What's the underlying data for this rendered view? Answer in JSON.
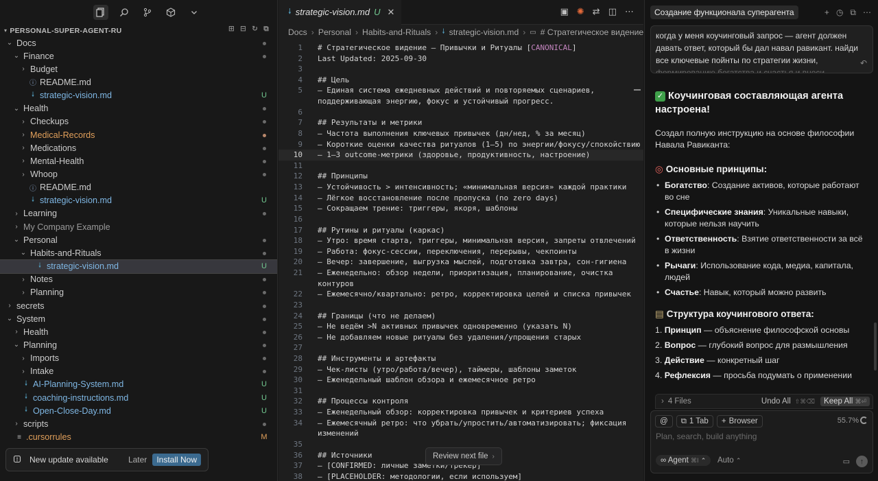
{
  "sidebar": {
    "title": "PERSONAL-SUPER-AGENT-RU",
    "tree": [
      {
        "label": "Docs",
        "kind": "folder",
        "open": true,
        "depth": 1,
        "status": "dot",
        "color": "default"
      },
      {
        "label": "Finance",
        "kind": "folder",
        "open": true,
        "depth": 2,
        "status": "dot",
        "color": "default"
      },
      {
        "label": "Budget",
        "kind": "folder",
        "open": false,
        "depth": 3,
        "status": "",
        "color": "default"
      },
      {
        "label": "README.md",
        "kind": "info",
        "depth": 3,
        "status": "",
        "color": "default"
      },
      {
        "label": "strategic-vision.md",
        "kind": "md",
        "depth": 3,
        "status": "U",
        "color": "untracked"
      },
      {
        "label": "Health",
        "kind": "folder",
        "open": true,
        "depth": 2,
        "status": "dot",
        "color": "default"
      },
      {
        "label": "Checkups",
        "kind": "folder",
        "open": false,
        "depth": 3,
        "status": "dot",
        "color": "default"
      },
      {
        "label": "Medical-Records",
        "kind": "folder",
        "open": false,
        "depth": 3,
        "status": "dot-orange",
        "color": "modified"
      },
      {
        "label": "Medications",
        "kind": "folder",
        "open": false,
        "depth": 3,
        "status": "dot",
        "color": "default"
      },
      {
        "label": "Mental-Health",
        "kind": "folder",
        "open": false,
        "depth": 3,
        "status": "dot",
        "color": "default"
      },
      {
        "label": "Whoop",
        "kind": "folder",
        "open": false,
        "depth": 3,
        "status": "dot",
        "color": "default"
      },
      {
        "label": "README.md",
        "kind": "info",
        "depth": 3,
        "status": "",
        "color": "default"
      },
      {
        "label": "strategic-vision.md",
        "kind": "md",
        "depth": 3,
        "status": "U",
        "color": "untracked"
      },
      {
        "label": "Learning",
        "kind": "folder",
        "open": false,
        "depth": 2,
        "status": "dot",
        "color": "default"
      },
      {
        "label": "My Company Example",
        "kind": "folder",
        "open": false,
        "depth": 2,
        "status": "",
        "color": "dim"
      },
      {
        "label": "Personal",
        "kind": "folder",
        "open": true,
        "depth": 2,
        "status": "dot",
        "color": "default"
      },
      {
        "label": "Habits-and-Rituals",
        "kind": "folder",
        "open": true,
        "depth": 3,
        "status": "dot",
        "color": "default"
      },
      {
        "label": "strategic-vision.md",
        "kind": "md",
        "depth": 4,
        "status": "U",
        "color": "untracked",
        "selected": true
      },
      {
        "label": "Notes",
        "kind": "folder",
        "open": false,
        "depth": 3,
        "status": "dot",
        "color": "default"
      },
      {
        "label": "Planning",
        "kind": "folder",
        "open": false,
        "depth": 3,
        "status": "dot",
        "color": "default"
      },
      {
        "label": "secrets",
        "kind": "folder",
        "open": false,
        "depth": 1,
        "status": "dot",
        "color": "default"
      },
      {
        "label": "System",
        "kind": "folder",
        "open": true,
        "depth": 1,
        "status": "dot",
        "color": "default"
      },
      {
        "label": "Health",
        "kind": "folder",
        "open": false,
        "depth": 2,
        "status": "dot",
        "color": "default"
      },
      {
        "label": "Planning",
        "kind": "folder",
        "open": true,
        "depth": 2,
        "status": "dot",
        "color": "default"
      },
      {
        "label": "Imports",
        "kind": "folder",
        "open": false,
        "depth": 3,
        "status": "dot",
        "color": "default"
      },
      {
        "label": "Intake",
        "kind": "folder",
        "open": false,
        "depth": 3,
        "status": "dot",
        "color": "default"
      },
      {
        "label": "AI-Planning-System.md",
        "kind": "md",
        "depth": 2,
        "status": "U",
        "color": "untracked"
      },
      {
        "label": "coaching-instructions.md",
        "kind": "md",
        "depth": 2,
        "status": "U",
        "color": "untracked"
      },
      {
        "label": "Open-Close-Day.md",
        "kind": "md",
        "depth": 2,
        "status": "U",
        "color": "untracked"
      },
      {
        "label": "scripts",
        "kind": "folder",
        "open": false,
        "depth": 2,
        "status": "dot",
        "color": "default"
      },
      {
        "label": ".cursorrules",
        "kind": "lines",
        "depth": 1,
        "status": "M",
        "color": "modified"
      }
    ],
    "toast": {
      "message": "New update available",
      "later": "Later",
      "install": "Install Now"
    }
  },
  "editor": {
    "tab_name": "strategic-vision.md",
    "tab_status": "U",
    "breadcrumb": [
      "Docs",
      "Personal",
      "Habits-and-Rituals",
      "strategic-vision.md",
      "# Стратегическое видение"
    ],
    "current_line": 10,
    "lines": [
      {
        "n": "1",
        "t": "# Стратегическое видение — Привычки и Ритуалы [",
        "k": "CANONICAL",
        "e": "]"
      },
      {
        "n": "2",
        "t": "Last Updated: 2025-09-30"
      },
      {
        "n": "3",
        "t": ""
      },
      {
        "n": "4",
        "t": "## Цель"
      },
      {
        "n": "5",
        "t": "– Единая система ежедневных действий и повторяемых сценариев,"
      },
      {
        "n": "",
        "t": "поддерживающая энергию, фокус и устойчивый прогресс."
      },
      {
        "n": "6",
        "t": ""
      },
      {
        "n": "7",
        "t": "## Результаты и метрики"
      },
      {
        "n": "8",
        "t": "– Частота выполнения ключевых привычек (дн/нед, % за месяц)"
      },
      {
        "n": "9",
        "t": "– Короткие оценки качества ритуалов (1–5) по энергии/фокусу/спокойствию"
      },
      {
        "n": "10",
        "t": "– 1–3 outcome-метрики (здоровье, продуктивность, настроение)"
      },
      {
        "n": "11",
        "t": ""
      },
      {
        "n": "12",
        "t": "## Принципы"
      },
      {
        "n": "13",
        "t": "– Устойчивость > интенсивность; «минимальная версия» каждой практики"
      },
      {
        "n": "14",
        "t": "– Лёгкое восстановление после пропуска (no zero days)"
      },
      {
        "n": "15",
        "t": "– Сокращаем трение: триггеры, якоря, шаблоны"
      },
      {
        "n": "16",
        "t": ""
      },
      {
        "n": "17",
        "t": "## Рутины и ритуалы (каркас)"
      },
      {
        "n": "18",
        "t": "– Утро: время старта, триггеры, минимальная версия, запреты отвлечений"
      },
      {
        "n": "19",
        "t": "– Работа: фокус-сессии, переключения, перерывы, чекпоинты"
      },
      {
        "n": "20",
        "t": "– Вечер: завершение, выгрузка мыслей, подготовка завтра, сон-гигиена"
      },
      {
        "n": "21",
        "t": "– Еженедельно: обзор недели, приоритизация, планирование, очистка"
      },
      {
        "n": "",
        "t": "контуров"
      },
      {
        "n": "22",
        "t": "– Ежемесячно/квартально: ретро, корректировка целей и списка привычек"
      },
      {
        "n": "23",
        "t": ""
      },
      {
        "n": "24",
        "t": "## Границы (что не делаем)"
      },
      {
        "n": "25",
        "t": "– Не ведём >N активных привычек одновременно (указать N)"
      },
      {
        "n": "26",
        "t": "– Не добавляем новые ритуалы без удаления/упрощения старых"
      },
      {
        "n": "27",
        "t": ""
      },
      {
        "n": "28",
        "t": "## Инструменты и артефакты"
      },
      {
        "n": "29",
        "t": "– Чек-листы (утро/работа/вечер), таймеры, шаблоны заметок"
      },
      {
        "n": "30",
        "t": "– Еженедельный шаблон обзора и ежемесячное ретро"
      },
      {
        "n": "31",
        "t": ""
      },
      {
        "n": "32",
        "t": "## Процессы контроля"
      },
      {
        "n": "33",
        "t": "– Еженедельный обзор: корректировка привычек и критериев успеха"
      },
      {
        "n": "34",
        "t": "– Ежемесячный ретро: что убрать/упростить/автоматизировать; фиксация"
      },
      {
        "n": "",
        "t": "изменений"
      },
      {
        "n": "35",
        "t": ""
      },
      {
        "n": "36",
        "t": "## Источники"
      },
      {
        "n": "37",
        "t": "– [CONFIRMED: личные заметки/трекер]"
      },
      {
        "n": "38",
        "t": "– [PLACEHOLDER: методологии, если используем]"
      }
    ],
    "review_button": "Review next file"
  },
  "chat": {
    "title": "Создание функционала суперагента",
    "prompt_text": "когда у меня коучинговый запрос — агент должен давать ответ, который бы дал навал равикант. найди все ключевые пойнты по стратегии жизни,",
    "prompt_fade": "формированию богатства и счастья и внеси",
    "heading": "Коучинговая составляющая агента настроена!",
    "intro": "Создал полную инструкцию на основе философии Навала Равиканта:",
    "principles_heading": "Основные принципы:",
    "principles": [
      {
        "term": "Богатство",
        "desc": ": Создание активов, которые работают во сне"
      },
      {
        "term": "Специфические знания",
        "desc": ": Уникальные навыки, которые нельзя научить"
      },
      {
        "term": "Ответственность",
        "desc": ": Взятие ответственности за всё в жизни"
      },
      {
        "term": "Рычаги",
        "desc": ": Использование кода, медиа, капитала, людей"
      },
      {
        "term": "Счастье",
        "desc": ": Навык, который можно развить"
      }
    ],
    "structure_heading": "Структура коучингового ответа:",
    "structure": [
      {
        "num": "1.",
        "term": "Принцип",
        "desc": " — объяснение философской основы"
      },
      {
        "num": "2.",
        "term": "Вопрос",
        "desc": " — глубокий вопрос для размышления"
      },
      {
        "num": "3.",
        "term": "Действие",
        "desc": " — конкретный шаг"
      },
      {
        "num": "4.",
        "term": "Рефлексия",
        "desc": " — просьба подумать о применении"
      }
    ],
    "files_count": "4 Files",
    "undo_all": "Undo All",
    "undo_kbd": "⇧⌘⌫",
    "keep_all": "Keep All",
    "keep_kbd": "⌘⏎",
    "tab_chip": "1 Tab",
    "browser_chip": "Browser",
    "context_pct": "55.7%",
    "placeholder": "Plan, search, build anything",
    "agent_label": "Agent",
    "agent_kbd": "⌘I",
    "model_label": "Auto"
  }
}
